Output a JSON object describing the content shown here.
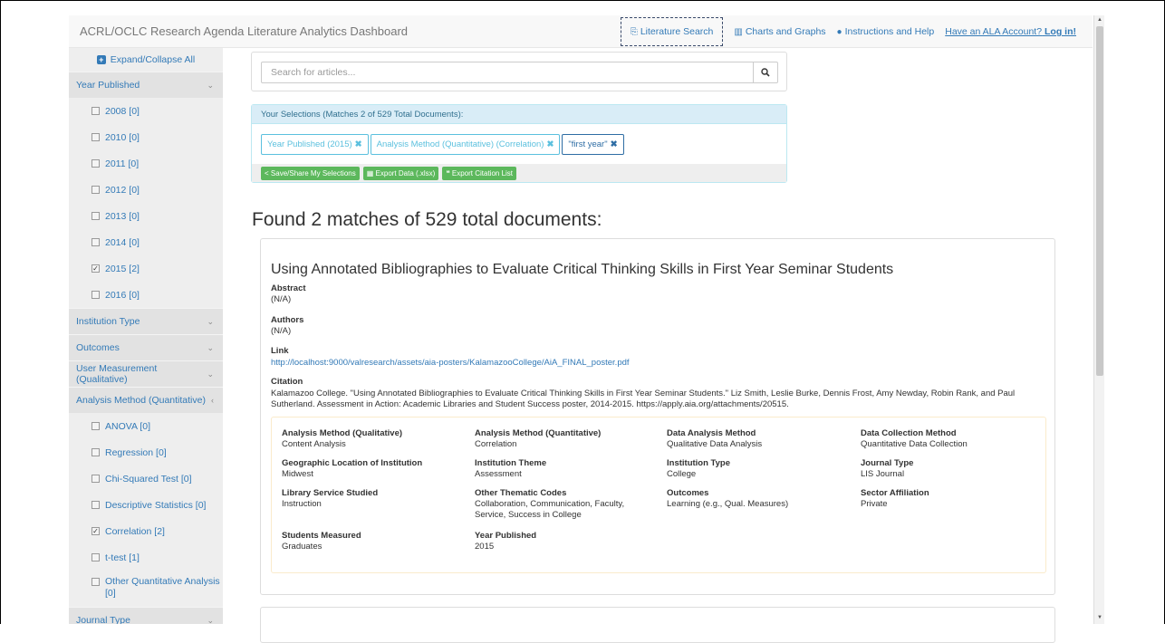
{
  "navbar": {
    "brand": "ACRL/OCLC Research Agenda Literature Analytics Dashboard",
    "links": {
      "literature_search": "Literature Search",
      "charts": "Charts and Graphs",
      "instructions": "Instructions and Help",
      "login_prefix": "Have an ALA Account?",
      "login": "Log in!"
    }
  },
  "sidebar": {
    "expand_label": "Expand/Collapse All",
    "year_header": "Year Published",
    "years": [
      {
        "label": "2008 [0]",
        "checked": false
      },
      {
        "label": "2010 [0]",
        "checked": false
      },
      {
        "label": "2011 [0]",
        "checked": false
      },
      {
        "label": "2012 [0]",
        "checked": false
      },
      {
        "label": "2013 [0]",
        "checked": false
      },
      {
        "label": "2014 [0]",
        "checked": false
      },
      {
        "label": "2015 [2]",
        "checked": true
      },
      {
        "label": "2016 [0]",
        "checked": false
      }
    ],
    "institution_type": "Institution Type",
    "outcomes": "Outcomes",
    "user_measurement": "User Measurement (Qualitative)",
    "analysis_header": "Analysis Method (Quantitative)",
    "analysis": [
      {
        "label": "ANOVA [0]",
        "checked": false
      },
      {
        "label": "Regression [0]",
        "checked": false
      },
      {
        "label": "Chi-Squared Test [0]",
        "checked": false
      },
      {
        "label": "Descriptive Statistics [0]",
        "checked": false
      },
      {
        "label": "Correlation [2]",
        "checked": true
      },
      {
        "label": "t-test [1]",
        "checked": false
      },
      {
        "label": "Other Quantitative Analysis [0]",
        "checked": false
      }
    ],
    "journal_type": "Journal Type"
  },
  "search": {
    "placeholder": "Search for articles..."
  },
  "selections": {
    "header": "Your Selections (Matches 2 of 529 Total Documents):",
    "tags": [
      "Year Published (2015)",
      "Analysis Method (Quantitative) (Correlation)",
      "\"first year\""
    ],
    "buttons": {
      "save": "Save/Share My Selections",
      "export_data": "Export Data (.xlsx)",
      "export_citation": "Export Citation List"
    }
  },
  "found": "Found 2 matches of 529 total documents:",
  "result": {
    "title": "Using Annotated Bibliographies to Evaluate Critical Thinking Skills in First Year Seminar Students",
    "abstract_label": "Abstract",
    "abstract": "(N/A)",
    "authors_label": "Authors",
    "authors": "(N/A)",
    "link_label": "Link",
    "link": "http://localhost:9000/valresearch/assets/aia-posters/KalamazooCollege/AiA_FINAL_poster.pdf",
    "citation_label": "Citation",
    "citation": "Kalamazoo College. \"Using Annotated Bibliographies to Evaluate Critical Thinking Skills in First Year Seminar Students.\" Liz Smith, Leslie Burke, Dennis Frost, Amy Newday, Robin Rank, and Paul Sutherland. Assessment in Action: Academic Libraries and Student Success poster, 2014-2015. https://apply.aia.org/attachments/20515.",
    "meta": [
      {
        "k": "Analysis Method (Qualitative)",
        "v": "Content Analysis"
      },
      {
        "k": "Analysis Method (Quantitative)",
        "v": "Correlation"
      },
      {
        "k": "Data Analysis Method",
        "v": "Qualitative Data Analysis"
      },
      {
        "k": "Data Collection Method",
        "v": "Quantitative Data Collection"
      },
      {
        "k": "Geographic Location of Institution",
        "v": "Midwest"
      },
      {
        "k": "Institution Theme",
        "v": "Assessment"
      },
      {
        "k": "Institution Type",
        "v": "College"
      },
      {
        "k": "Journal Type",
        "v": "LIS Journal"
      },
      {
        "k": "Library Service Studied",
        "v": "Instruction"
      },
      {
        "k": "Other Thematic Codes",
        "v": "Collaboration, Communication, Faculty, Service, Success in College"
      },
      {
        "k": "Outcomes",
        "v": "Learning (e.g., Qual. Measures)"
      },
      {
        "k": "Sector Affiliation",
        "v": "Private"
      },
      {
        "k": "Students Measured",
        "v": "Graduates"
      },
      {
        "k": "Year Published",
        "v": "2015"
      }
    ]
  }
}
